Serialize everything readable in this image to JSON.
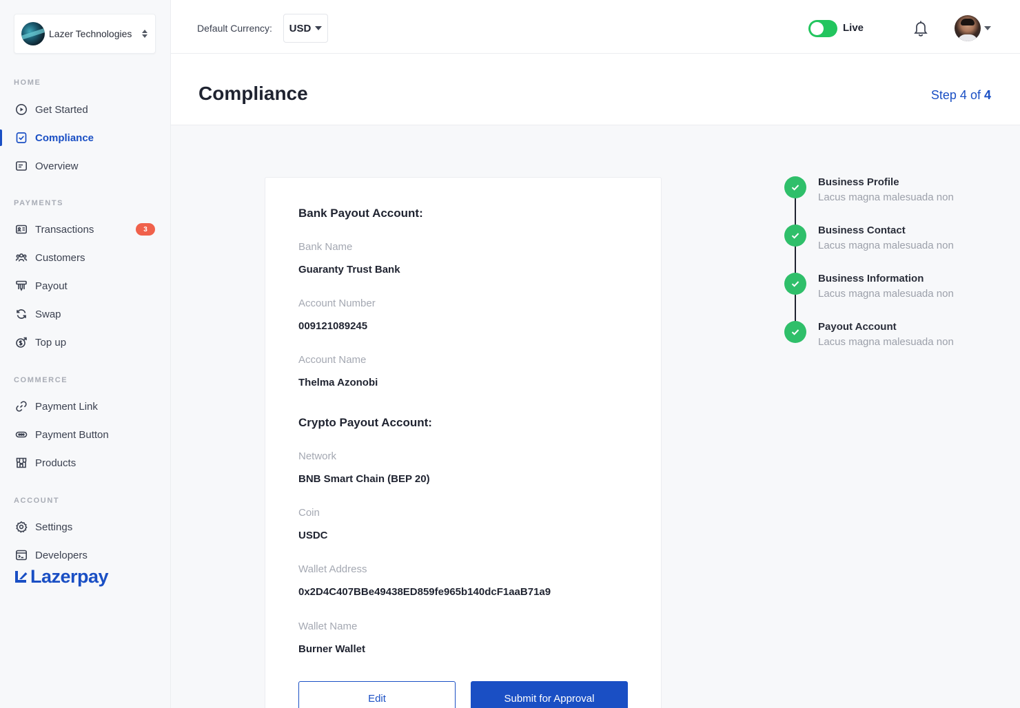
{
  "org": {
    "name": "Lazer Technologies"
  },
  "sidebar": {
    "sections": {
      "home": "HOME",
      "payments": "PAYMENTS",
      "commerce": "COMMERCE",
      "account": "ACCOUNT"
    },
    "items": {
      "get_started": "Get Started",
      "compliance": "Compliance",
      "overview": "Overview",
      "transactions": "Transactions",
      "transactions_badge": "3",
      "customers": "Customers",
      "payout": "Payout",
      "swap": "Swap",
      "top_up": "Top up",
      "payment_link": "Payment Link",
      "payment_button": "Payment Button",
      "products": "Products",
      "settings": "Settings",
      "developers": "Developers"
    },
    "brand": "Lazerpay"
  },
  "topbar": {
    "currency_label": "Default Currency:",
    "currency_value": "USD",
    "live_label": "Live"
  },
  "page": {
    "title": "Compliance",
    "step_prefix": "Step 4 of",
    "step_total": "4"
  },
  "card": {
    "bank_heading": "Bank Payout Account:",
    "bank_name_label": "Bank Name",
    "bank_name_value": "Guaranty Trust Bank",
    "account_number_label": "Account Number",
    "account_number_value": "009121089245",
    "account_name_label": "Account Name",
    "account_name_value": "Thelma Azonobi",
    "crypto_heading": "Crypto Payout Account:",
    "network_label": "Network",
    "network_value": "BNB Smart Chain (BEP 20)",
    "coin_label": "Coin",
    "coin_value": "USDC",
    "wallet_address_label": "Wallet Address",
    "wallet_address_value": "0x2D4C407BBe49438ED859fe965b140dcF1aaB71a9",
    "wallet_name_label": "Wallet Name",
    "wallet_name_value": "Burner Wallet",
    "edit_label": "Edit",
    "submit_label": "Submit for Approval"
  },
  "stepper": [
    {
      "title": "Business Profile",
      "desc": "Lacus magna malesuada non"
    },
    {
      "title": "Business Contact",
      "desc": "Lacus magna malesuada non"
    },
    {
      "title": "Business Information",
      "desc": "Lacus magna malesuada non"
    },
    {
      "title": "Payout Account",
      "desc": "Lacus magna malesuada non"
    }
  ],
  "colors": {
    "accent": "#1a4fc4",
    "success": "#2fbf6a",
    "badge": "#f0614b",
    "toggle_on": "#22c55e"
  }
}
